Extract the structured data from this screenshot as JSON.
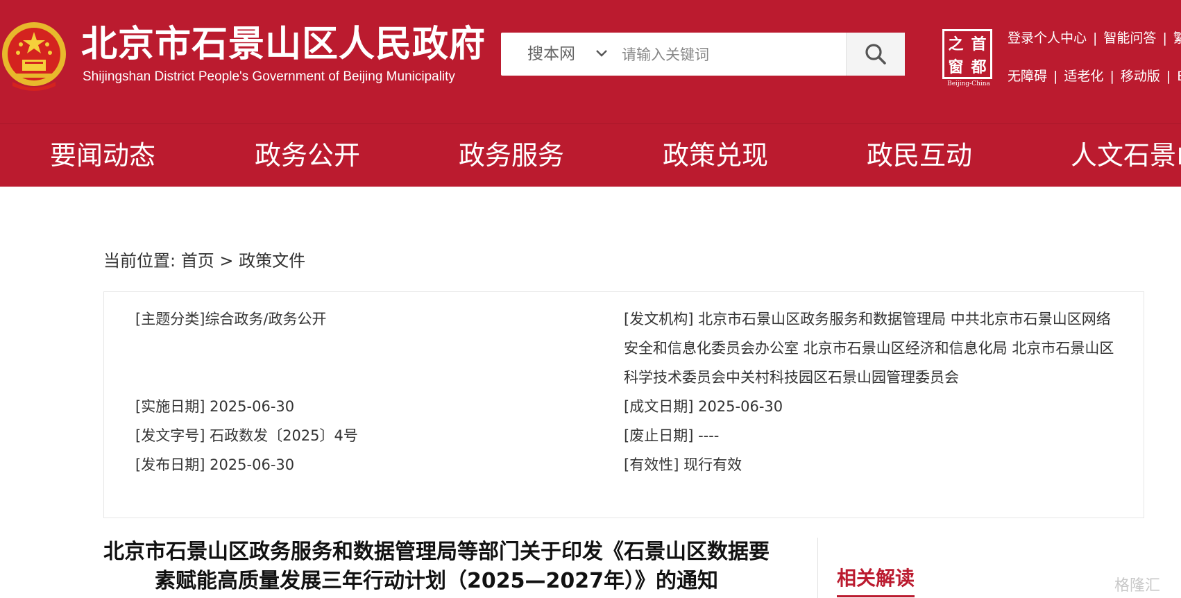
{
  "header": {
    "site_title_cn": "北京市石景山区人民政府",
    "site_title_en": "Shijingshan District People's Government of Beijing Municipality",
    "search": {
      "scope_label": "搜本网",
      "placeholder": "请输入关键词"
    },
    "capital_logo": {
      "chars": [
        "之",
        "首",
        "窗",
        "都"
      ],
      "caption": "Beijing-China"
    },
    "top_links_row1": [
      "登录个人中心",
      "智能问答",
      "繁"
    ],
    "top_links_row2": [
      "无障碍",
      "适老化",
      "移动版",
      "E"
    ],
    "brand_color": "#bb1b2f"
  },
  "nav": {
    "items": [
      "要闻动态",
      "政务公开",
      "政务服务",
      "政策兑现",
      "政民互动",
      "人文石景山"
    ]
  },
  "breadcrumb": {
    "prefix": "当前位置:",
    "home": "首页",
    "separator": " > ",
    "current": "政策文件"
  },
  "meta": {
    "topic": {
      "key": "[主题分类]",
      "value": "综合政务/政务公开"
    },
    "issuer": {
      "key": "[发文机构]",
      "value": "北京市石景山区政务服务和数据管理局 中共北京市石景山区网络安全和信息化委员会办公室 北京市石景山区经济和信息化局 北京市石景山区科学技术委员会中关村科技园区石景山园管理委员会"
    },
    "effective_date": {
      "key": "[实施日期]",
      "value": "2025-06-30"
    },
    "written_date": {
      "key": "[成文日期]",
      "value": "2025-06-30"
    },
    "doc_number": {
      "key": "[发文字号]",
      "value": "石政数发〔2025〕4号"
    },
    "repeal_date": {
      "key": "[废止日期]",
      "value": "----"
    },
    "publish_date": {
      "key": "[发布日期]",
      "value": "2025-06-30"
    },
    "validity": {
      "key": "[有效性]",
      "value": "现行有效"
    }
  },
  "article": {
    "title_line1": "北京市石景山区政务服务和数据管理局等部门关于印发《石景山区数据要",
    "title_line2": "素赋能高质量发展三年行动计划（2025—2027年）》的通知"
  },
  "sidebar": {
    "related_tab": "相关解读"
  },
  "watermark": "格隆汇"
}
